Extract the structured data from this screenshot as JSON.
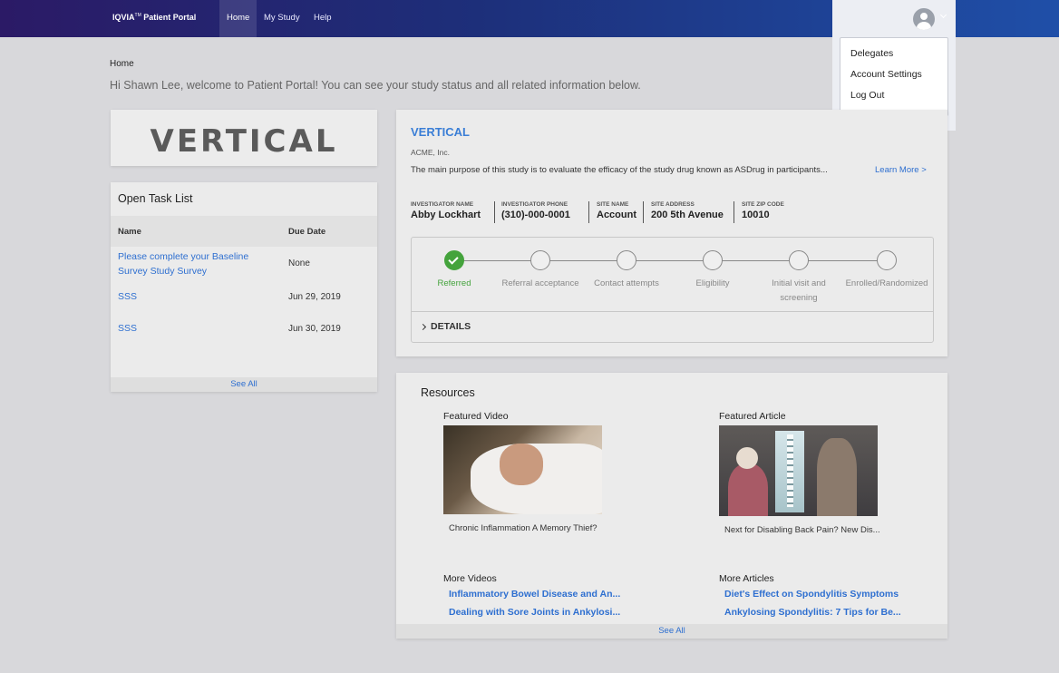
{
  "nav": {
    "brand": "IQVIA",
    "brand_tm": "TM",
    "brand_suffix": " Patient Portal",
    "items": [
      {
        "label": "Home"
      },
      {
        "label": "My Study"
      },
      {
        "label": "Help"
      }
    ]
  },
  "account_menu": {
    "items": [
      {
        "label": "Delegates"
      },
      {
        "label": "Account Settings"
      },
      {
        "label": "Log Out"
      }
    ]
  },
  "breadcrumb": "Home",
  "welcome": "Hi Shawn Lee, welcome to Patient Portal! You can see your study status and all related information below.",
  "study_logo": "VERTICAL",
  "tasks": {
    "title": "Open Task List",
    "col_name": "Name",
    "col_due": "Due Date",
    "rows": [
      {
        "name": "Please complete your Baseline Survey Study Survey",
        "due": "None"
      },
      {
        "name": "SSS",
        "due": "Jun 29, 2019"
      },
      {
        "name": "SSS",
        "due": "Jun 30, 2019"
      }
    ],
    "see_all": "See All"
  },
  "study": {
    "title": "VERTICAL",
    "sponsor": "ACME, Inc.",
    "purpose": "The main purpose of this study is to evaluate the efficacy of the study drug known as ASDrug in participants...",
    "learn_more": "Learn More >",
    "info": [
      {
        "label": "INVESTIGATOR NAME",
        "value": "Abby Lockhart"
      },
      {
        "label": "INVESTIGATOR PHONE",
        "value": "(310)-000-0001"
      },
      {
        "label": "SITE NAME",
        "value": "Account"
      },
      {
        "label": "SITE ADDRESS",
        "value": "200 5th Avenue"
      },
      {
        "label": "SITE ZIP CODE",
        "value": "10010"
      }
    ],
    "steps": [
      {
        "label": "Referred",
        "status": "complete"
      },
      {
        "label": "Referral acceptance",
        "status": "pending"
      },
      {
        "label": "Contact attempts",
        "status": "pending"
      },
      {
        "label": "Eligibility",
        "status": "pending"
      },
      {
        "label": "Initial visit and screening",
        "status": "pending"
      },
      {
        "label": "Enrolled/Randomized",
        "status": "pending"
      }
    ],
    "details_label": "DETAILS"
  },
  "resources": {
    "title": "Resources",
    "featured_video": {
      "heading": "Featured Video",
      "caption": "Chronic Inflammation A Memory Thief?"
    },
    "featured_article": {
      "heading": "Featured Article",
      "caption": "Next for Disabling Back Pain? New Dis..."
    },
    "more_videos": {
      "heading": "More Videos",
      "links": [
        "Inflammatory Bowel Disease and An...",
        "Dealing with Sore Joints in Ankylosi..."
      ]
    },
    "more_articles": {
      "heading": "More Articles",
      "links": [
        "Diet's Effect on Spondylitis Symptoms",
        "Ankylosing Spondylitis: 7 Tips for Be..."
      ]
    },
    "see_all": "See All"
  },
  "colors": {
    "accent_link": "#2e6fd0",
    "complete_green": "#44a33c",
    "nav_gradient_start": "#2b1a66",
    "nav_gradient_end": "#1f4fa8"
  }
}
